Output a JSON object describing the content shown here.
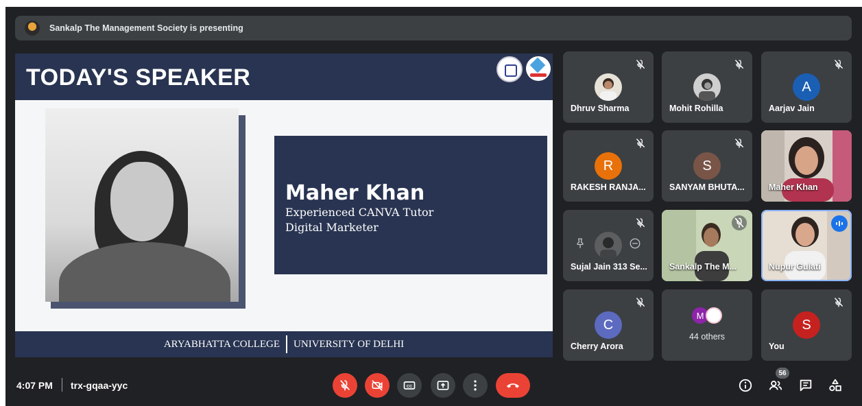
{
  "banner": {
    "text": "Sankalp The Management Society is presenting",
    "icon": "society-logo-icon"
  },
  "slide": {
    "title": "TODAY'S SPEAKER",
    "speaker_name": "Maher Khan",
    "speaker_role_1": "Experienced CANVA Tutor",
    "speaker_role_2": "Digital Marketer",
    "footer_left": "ARYABHATTA COLLEGE",
    "footer_right": "UNIVERSITY OF DELHI",
    "colors": {
      "navy": "#283451",
      "background": "#f5f6f8"
    }
  },
  "participants": [
    {
      "name": "Dhruv Sharma",
      "muted": true,
      "avatar": "photo"
    },
    {
      "name": "Mohit Rohilla",
      "muted": true,
      "avatar": "photo"
    },
    {
      "name": "Aarjav Jain",
      "muted": true,
      "initial": "A",
      "color": "#1a5fb4"
    },
    {
      "name": "RAKESH RANJA...",
      "muted": true,
      "initial": "R",
      "color": "#e8710a"
    },
    {
      "name": "SANYAM BHUTA...",
      "muted": true,
      "initial": "S",
      "color": "#795548"
    },
    {
      "name": "Maher Khan",
      "muted": false,
      "avatar": "video"
    },
    {
      "name": "Sujal Jain 313 Se...",
      "muted": true,
      "avatar": "photo"
    },
    {
      "name": "Sankalp The M...",
      "muted": true,
      "avatar": "video"
    },
    {
      "name": "Nupur Gulati",
      "muted": false,
      "speaking": true,
      "avatar": "video"
    },
    {
      "name": "Cherry Arora",
      "muted": true,
      "initial": "C",
      "color": "#5c6bc0"
    },
    {
      "name": "You",
      "muted": true,
      "initial": "S",
      "color": "#c5221f"
    }
  ],
  "others_tile": {
    "label": "44 others",
    "initial": "M",
    "initial_color": "#8e24aa"
  },
  "bottom_bar": {
    "time": "4:07 PM",
    "meeting_code": "trx-gqaa-yyc",
    "people_count": "56",
    "controls": [
      "mic-off-icon",
      "camera-off-icon",
      "captions-icon",
      "present-icon",
      "more-options-icon",
      "end-call-icon"
    ],
    "side_controls": [
      "info-icon",
      "people-icon",
      "chat-icon",
      "activities-icon"
    ]
  }
}
